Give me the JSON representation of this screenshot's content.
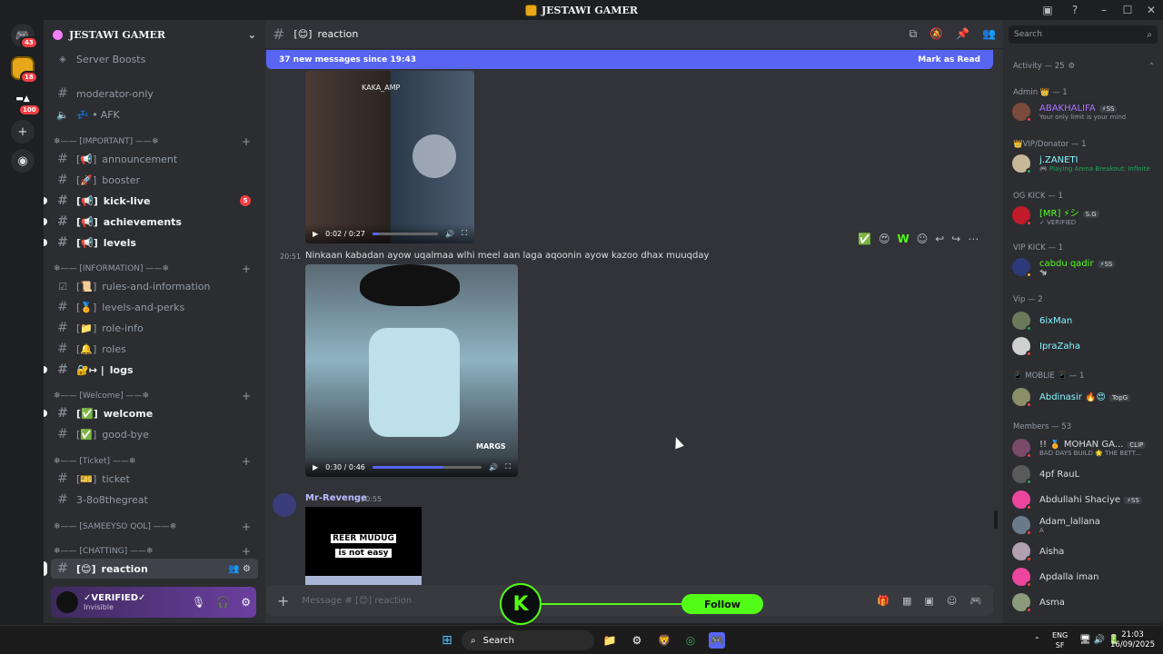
{
  "window": {
    "title": "JESTAWI GAMER"
  },
  "servers": {
    "badge_top": "43",
    "badge_guild": "18",
    "badge_third": "100"
  },
  "sidebar": {
    "guild_name": "JESTAWI GAMER",
    "boosts": "Server Boosts",
    "channels": [
      {
        "label": "moderator-only"
      },
      {
        "label": "AFK"
      },
      {
        "label": "announcement"
      },
      {
        "label": "booster"
      },
      {
        "label": "kick-live",
        "badge": "5"
      },
      {
        "label": "achievements"
      },
      {
        "label": "levels"
      },
      {
        "label": "rules-and-information"
      },
      {
        "label": "levels-and-perks"
      },
      {
        "label": "role-info"
      },
      {
        "label": "roles"
      },
      {
        "label": "logs"
      },
      {
        "label": "welcome"
      },
      {
        "label": "good-bye"
      },
      {
        "label": "ticket"
      },
      {
        "label": "3-8o8thegreat"
      },
      {
        "label": "reaction"
      }
    ],
    "categories": [
      "❄—— [IMPORTANT] ——❄",
      "❄—— [INFORMATION] ——❄",
      "❄—— [Welcome] ——❄",
      "❄—— [Ticket] ——❄",
      "❄—— [SAMEEYSO QOL] ——❄",
      "❄—— [CHATTING] ——❄"
    ]
  },
  "user": {
    "name": "✓VERIFIED✓",
    "status": "Invisible"
  },
  "channel": {
    "title": "reaction",
    "prefix": "[😊]"
  },
  "banner": {
    "text": "37 new messages since 19:43",
    "action": "Mark as Read"
  },
  "messages": {
    "video1": {
      "time": "0:02 / 0:27",
      "watermark": "KAKA_AMP"
    },
    "msg2": {
      "time": "20:51",
      "text": "Ninkaan kabadan ayow uqalmaa wlhi meel aan laga aqoonin ayow kazoo dhax muuqday"
    },
    "video2": {
      "time": "0:30 / 0:46",
      "watermark": "MARGS"
    },
    "msg3": {
      "author": "Mr-Revenge",
      "time": "20:55",
      "img_top": "REER MUDUG",
      "img_bottom": "is not easy"
    }
  },
  "composer": {
    "placeholder": "Message # [😊] reaction"
  },
  "kick": {
    "follow": "Follow"
  },
  "members": {
    "search_placeholder": "Search",
    "activity": "Activity — 25",
    "groups": [
      {
        "label": "Admin 👑 — 1"
      },
      {
        "label": "👑VIP/Donator — 1"
      },
      {
        "label": "OG KICK — 1"
      },
      {
        "label": "VIP KICK — 1"
      },
      {
        "label": "Vip — 2"
      },
      {
        "label": "📱 MOBLIE 📱 — 1"
      },
      {
        "label": "Members — 53"
      }
    ],
    "list": [
      {
        "name": "ABAKHALIFA",
        "sub": "Your only limit is your mind",
        "tag": "⚡SS"
      },
      {
        "name": "j.ZANETI",
        "sub": "🎮 Playing Arena Breakout: Infinite",
        "tag": ""
      },
      {
        "name": "[MR] ⚡シ",
        "sub": "✓ VERIFIED",
        "tag": "S.G"
      },
      {
        "name": "cabdu qadir",
        "sub": "🐄",
        "tag": "⚡SS"
      },
      {
        "name": "6ixMan",
        "sub": "",
        "tag": ""
      },
      {
        "name": "IpraZaha",
        "sub": "",
        "tag": ""
      },
      {
        "name": "Abdinasir 🔥😍",
        "sub": "",
        "tag": "TopG"
      },
      {
        "name": "!! 🏅 MOHAN GA...",
        "sub": "BAD DAYS BUILD 🌟 THE BETT...",
        "tag": "CLIP"
      },
      {
        "name": "4pf RauL",
        "sub": "",
        "tag": ""
      },
      {
        "name": "Abdullahi Shaciye",
        "sub": "",
        "tag": "⚡SS"
      },
      {
        "name": "Adam_lallana",
        "sub": "",
        "tag": "A"
      },
      {
        "name": "Aisha",
        "sub": "",
        "tag": ""
      },
      {
        "name": "Apdalla iman",
        "sub": "",
        "tag": ""
      },
      {
        "name": "Asma",
        "sub": "",
        "tag": ""
      }
    ]
  },
  "taskbar": {
    "search": "Search",
    "lang": "ENG",
    "lang2": "SF",
    "time": "21:03",
    "date": "16/09/2025"
  },
  "colors": {
    "accent": "#5865f2",
    "kick": "#53fc18",
    "danger": "#f23f43"
  }
}
